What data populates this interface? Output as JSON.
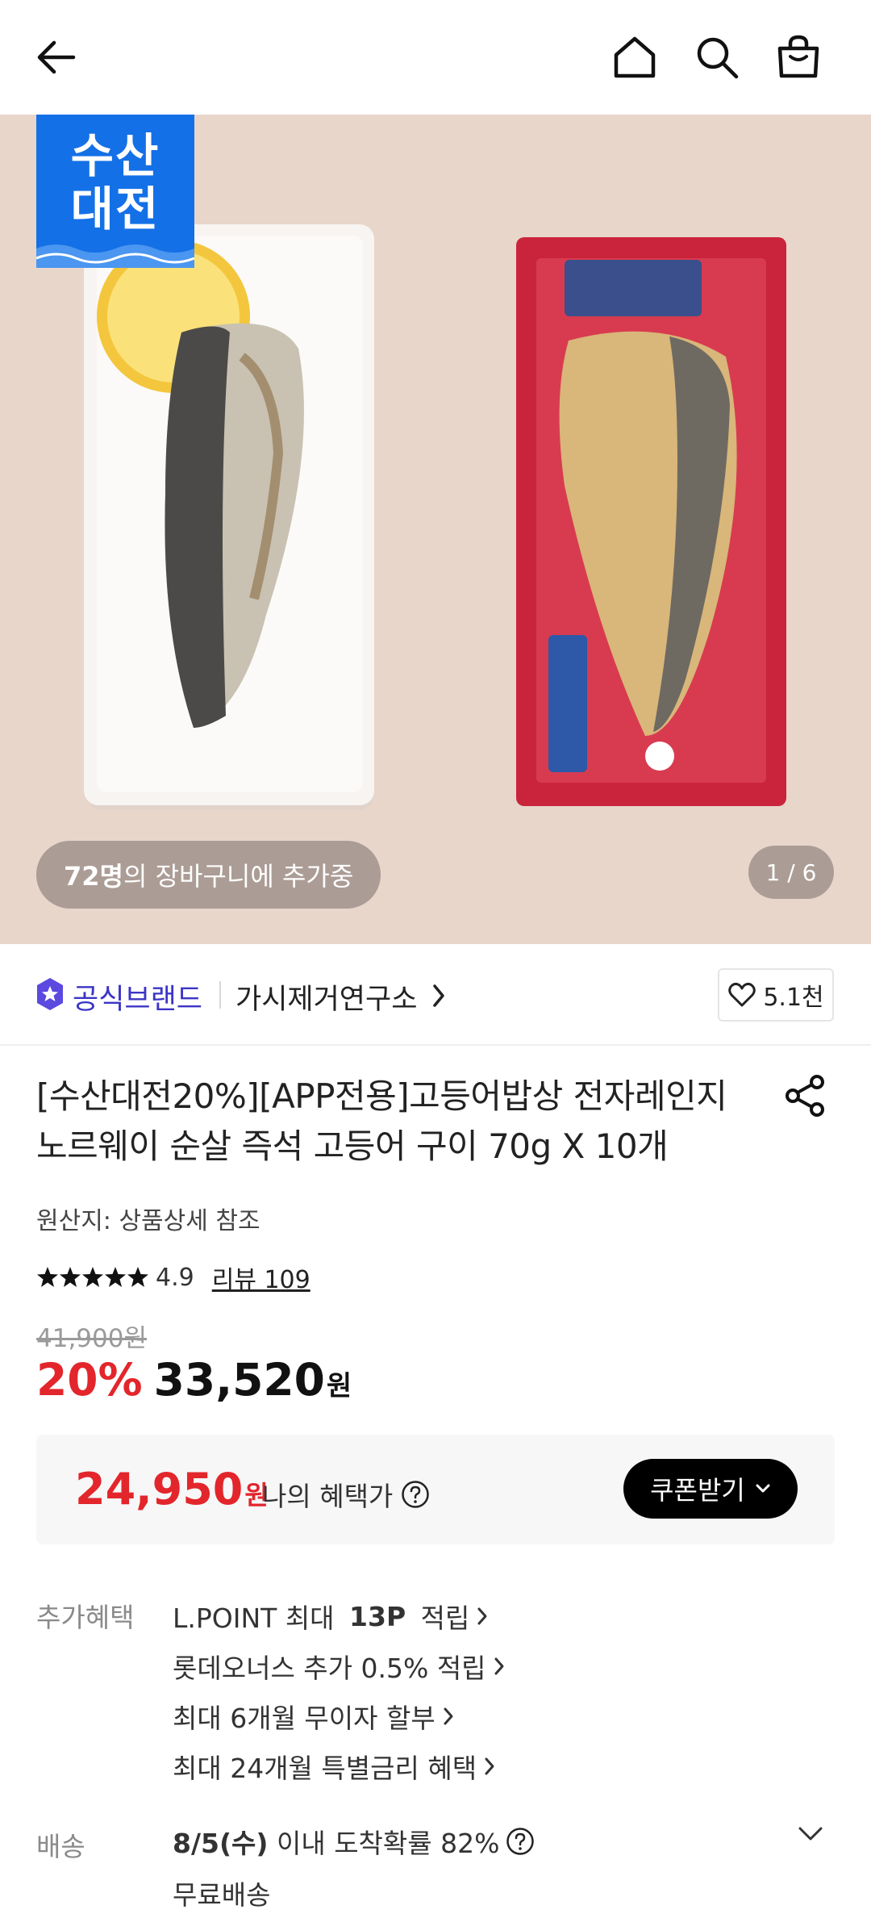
{
  "hero": {
    "logo_line1": "수산",
    "logo_line2": "대전",
    "cart_count": "72명",
    "cart_text": "의 장바구니에 추가중",
    "page_indicator": "1 / 6"
  },
  "brand": {
    "official_label": "공식브랜드",
    "store_name": "가시제거연구소",
    "likes": "5.1천"
  },
  "product": {
    "title": "[수산대전20%][APP전용]고등어밥상 전자레인지 노르웨이 순살 즉석 고등어 구이 70g X 10개",
    "origin": "원산지: 상품상세 참조",
    "rating": "4.9",
    "reviews": "리뷰 109",
    "original_price": "41,900원",
    "discount": "20%",
    "price": "33,520",
    "currency": "원"
  },
  "benefit_box": {
    "price": "24,950",
    "currency": "원",
    "label": "나의 혜택가",
    "coupon_button": "쿠폰받기"
  },
  "extra": {
    "label": "추가혜택",
    "items": [
      {
        "prefix": "L.POINT 최대 ",
        "bold": "13P",
        "suffix": " 적립"
      },
      {
        "prefix": "롯데오너스 추가 0.5% 적립",
        "bold": "",
        "suffix": ""
      },
      {
        "prefix": "최대 6개월 무이자 할부",
        "bold": "",
        "suffix": ""
      },
      {
        "prefix": "최대 24개월 특별금리 혜택",
        "bold": "",
        "suffix": ""
      }
    ]
  },
  "shipping": {
    "label": "배송",
    "date": "8/5(수)",
    "probability": " 이내 도착확률 82%",
    "fee": "무료배송"
  },
  "colors": {
    "accent_red": "#e2262c",
    "official_purple": "#3b35c7",
    "logo_blue": "#1470e6"
  }
}
